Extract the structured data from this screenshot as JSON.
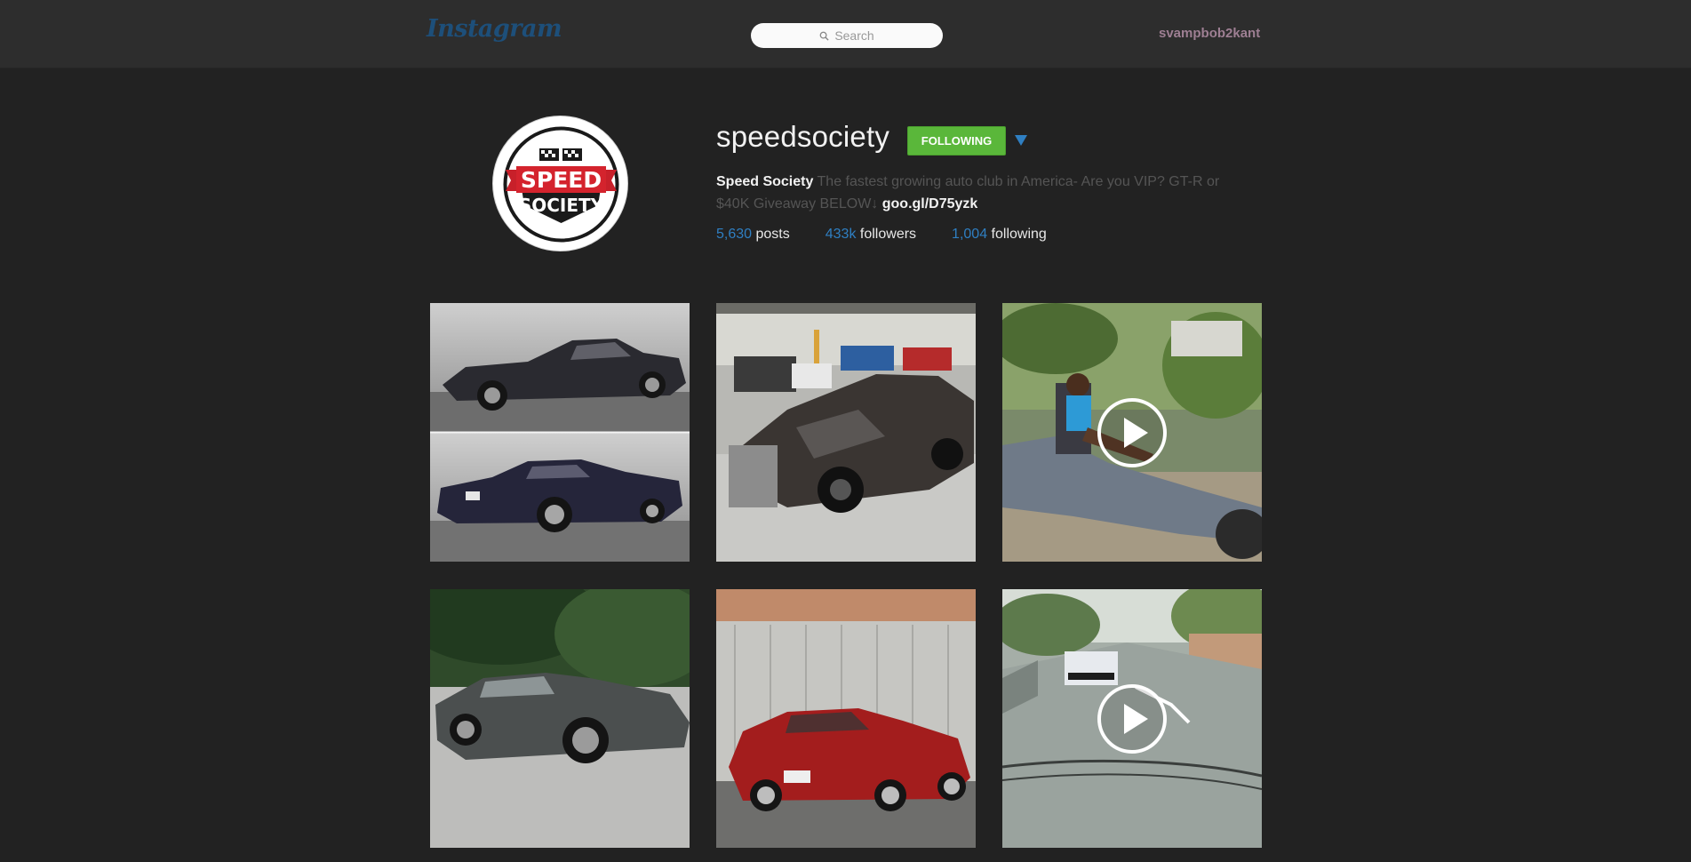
{
  "header": {
    "logo_text": "Instagram",
    "search_placeholder": "Search",
    "username": "svampbob2kant"
  },
  "profile": {
    "username": "speedsociety",
    "avatar_logo_line1": "SPEED",
    "avatar_logo_line2": "SOCIETY",
    "follow_label": "FOLLOWING",
    "full_name": "Speed Society",
    "bio_text": "The fastest growing auto club in America- Are you VIP? GT-R or $40K Giveaway BELOW↓",
    "bio_link": "goo.gl/D75yzk",
    "stats": {
      "posts_count": "5,630",
      "posts_label": "posts",
      "followers_count": "433k",
      "followers_label": "followers",
      "following_count": "1,004",
      "following_label": "following"
    }
  },
  "colors": {
    "accent_blue": "#2f7fc2",
    "follow_green": "#5ab73a",
    "background": "#222222",
    "topbar": "#2d2d2d"
  },
  "posts": [
    {
      "type": "image",
      "icon": "none"
    },
    {
      "type": "image",
      "icon": "none"
    },
    {
      "type": "video",
      "icon": "play-icon"
    },
    {
      "type": "image",
      "icon": "none"
    },
    {
      "type": "image",
      "icon": "none"
    },
    {
      "type": "video",
      "icon": "play-icon"
    }
  ]
}
